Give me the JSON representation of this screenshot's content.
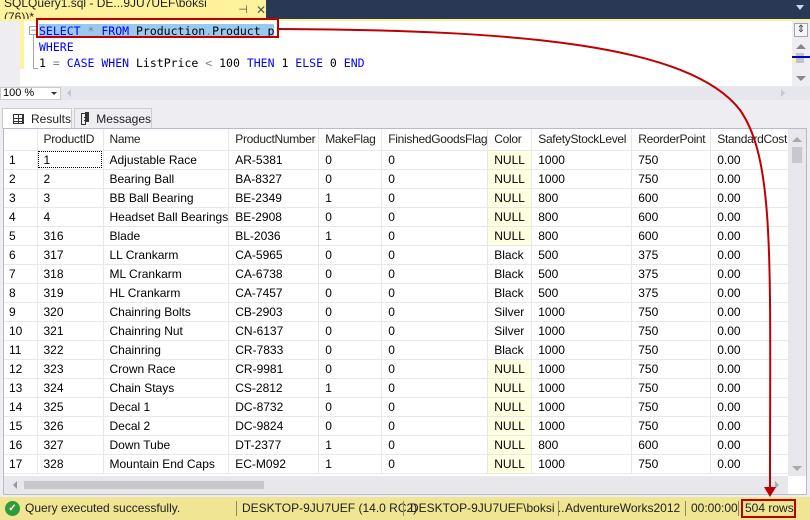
{
  "window": {
    "doc_tab_title": "SQLQuery1.sql - DE...9JU7UEF\\boksi (76))*",
    "pin_icon": "pin-icon",
    "close_icon": "close-icon"
  },
  "editor": {
    "lines": [
      {
        "tokens": [
          {
            "t": "SELECT",
            "c": "kw"
          },
          {
            "t": " "
          },
          {
            "t": "*",
            "c": "op"
          },
          {
            "t": " "
          },
          {
            "t": "FROM",
            "c": "kw"
          },
          {
            "t": " Production"
          },
          {
            "t": ".",
            "c": "op"
          },
          {
            "t": "Product p"
          }
        ]
      },
      {
        "tokens": [
          {
            "t": "WHERE",
            "c": "kw"
          }
        ]
      },
      {
        "tokens": [
          {
            "t": "1 "
          },
          {
            "t": "=",
            "c": "op"
          },
          {
            "t": " "
          },
          {
            "t": "CASE",
            "c": "kw"
          },
          {
            "t": " "
          },
          {
            "t": "WHEN",
            "c": "kw"
          },
          {
            "t": " ListPrice "
          },
          {
            "t": "<",
            "c": "op"
          },
          {
            "t": " 100 "
          },
          {
            "t": "THEN",
            "c": "kw"
          },
          {
            "t": " 1 "
          },
          {
            "t": "ELSE",
            "c": "kw"
          },
          {
            "t": " 0 "
          },
          {
            "t": "END",
            "c": "kw"
          }
        ]
      }
    ],
    "fold_glyph": "−",
    "zoom_level": "100 %"
  },
  "results": {
    "tabs": [
      {
        "label": "Results",
        "icon": "grid-icon",
        "active": true
      },
      {
        "label": "Messages",
        "icon": "messages-icon",
        "active": false
      }
    ],
    "columns": [
      "",
      "ProductID",
      "Name",
      "ProductNumber",
      "MakeFlag",
      "FinishedGoodsFlag",
      "Color",
      "SafetyStockLevel",
      "ReorderPoint",
      "StandardCost"
    ],
    "rows": [
      [
        "1",
        "1",
        "Adjustable Race",
        "AR-5381",
        "0",
        "0",
        "NULL",
        "1000",
        "750",
        "0.00"
      ],
      [
        "2",
        "2",
        "Bearing Ball",
        "BA-8327",
        "0",
        "0",
        "NULL",
        "1000",
        "750",
        "0.00"
      ],
      [
        "3",
        "3",
        "BB Ball Bearing",
        "BE-2349",
        "1",
        "0",
        "NULL",
        "800",
        "600",
        "0.00"
      ],
      [
        "4",
        "4",
        "Headset Ball Bearings",
        "BE-2908",
        "0",
        "0",
        "NULL",
        "800",
        "600",
        "0.00"
      ],
      [
        "5",
        "316",
        "Blade",
        "BL-2036",
        "1",
        "0",
        "NULL",
        "800",
        "600",
        "0.00"
      ],
      [
        "6",
        "317",
        "LL Crankarm",
        "CA-5965",
        "0",
        "0",
        "Black",
        "500",
        "375",
        "0.00"
      ],
      [
        "7",
        "318",
        "ML Crankarm",
        "CA-6738",
        "0",
        "0",
        "Black",
        "500",
        "375",
        "0.00"
      ],
      [
        "8",
        "319",
        "HL Crankarm",
        "CA-7457",
        "0",
        "0",
        "Black",
        "500",
        "375",
        "0.00"
      ],
      [
        "9",
        "320",
        "Chainring Bolts",
        "CB-2903",
        "0",
        "0",
        "Silver",
        "1000",
        "750",
        "0.00"
      ],
      [
        "10",
        "321",
        "Chainring Nut",
        "CN-6137",
        "0",
        "0",
        "Silver",
        "1000",
        "750",
        "0.00"
      ],
      [
        "11",
        "322",
        "Chainring",
        "CR-7833",
        "0",
        "0",
        "Black",
        "1000",
        "750",
        "0.00"
      ],
      [
        "12",
        "323",
        "Crown Race",
        "CR-9981",
        "0",
        "0",
        "NULL",
        "1000",
        "750",
        "0.00"
      ],
      [
        "13",
        "324",
        "Chain Stays",
        "CS-2812",
        "1",
        "0",
        "NULL",
        "1000",
        "750",
        "0.00"
      ],
      [
        "14",
        "325",
        "Decal 1",
        "DC-8732",
        "0",
        "0",
        "NULL",
        "1000",
        "750",
        "0.00"
      ],
      [
        "15",
        "326",
        "Decal 2",
        "DC-9824",
        "0",
        "0",
        "NULL",
        "1000",
        "750",
        "0.00"
      ],
      [
        "16",
        "327",
        "Down Tube",
        "DT-2377",
        "1",
        "0",
        "NULL",
        "800",
        "600",
        "0.00"
      ],
      [
        "17",
        "328",
        "Mountain End Caps",
        "EC-M092",
        "1",
        "0",
        "NULL",
        "1000",
        "750",
        "0.00"
      ]
    ]
  },
  "status": {
    "message": "Query executed successfully.",
    "server": "DESKTOP-9JU7UEF (14.0 RC2)",
    "user": "DESKTOP-9JU7UEF\\boksi ...",
    "database": "AdventureWorks2012",
    "elapsed": "00:00:00",
    "row_count": "504 rows"
  },
  "colors": {
    "annotation": "#c00000",
    "status_bar": "#efe593",
    "null_cell": "#ffffe1",
    "keyword": "#0000ff"
  }
}
